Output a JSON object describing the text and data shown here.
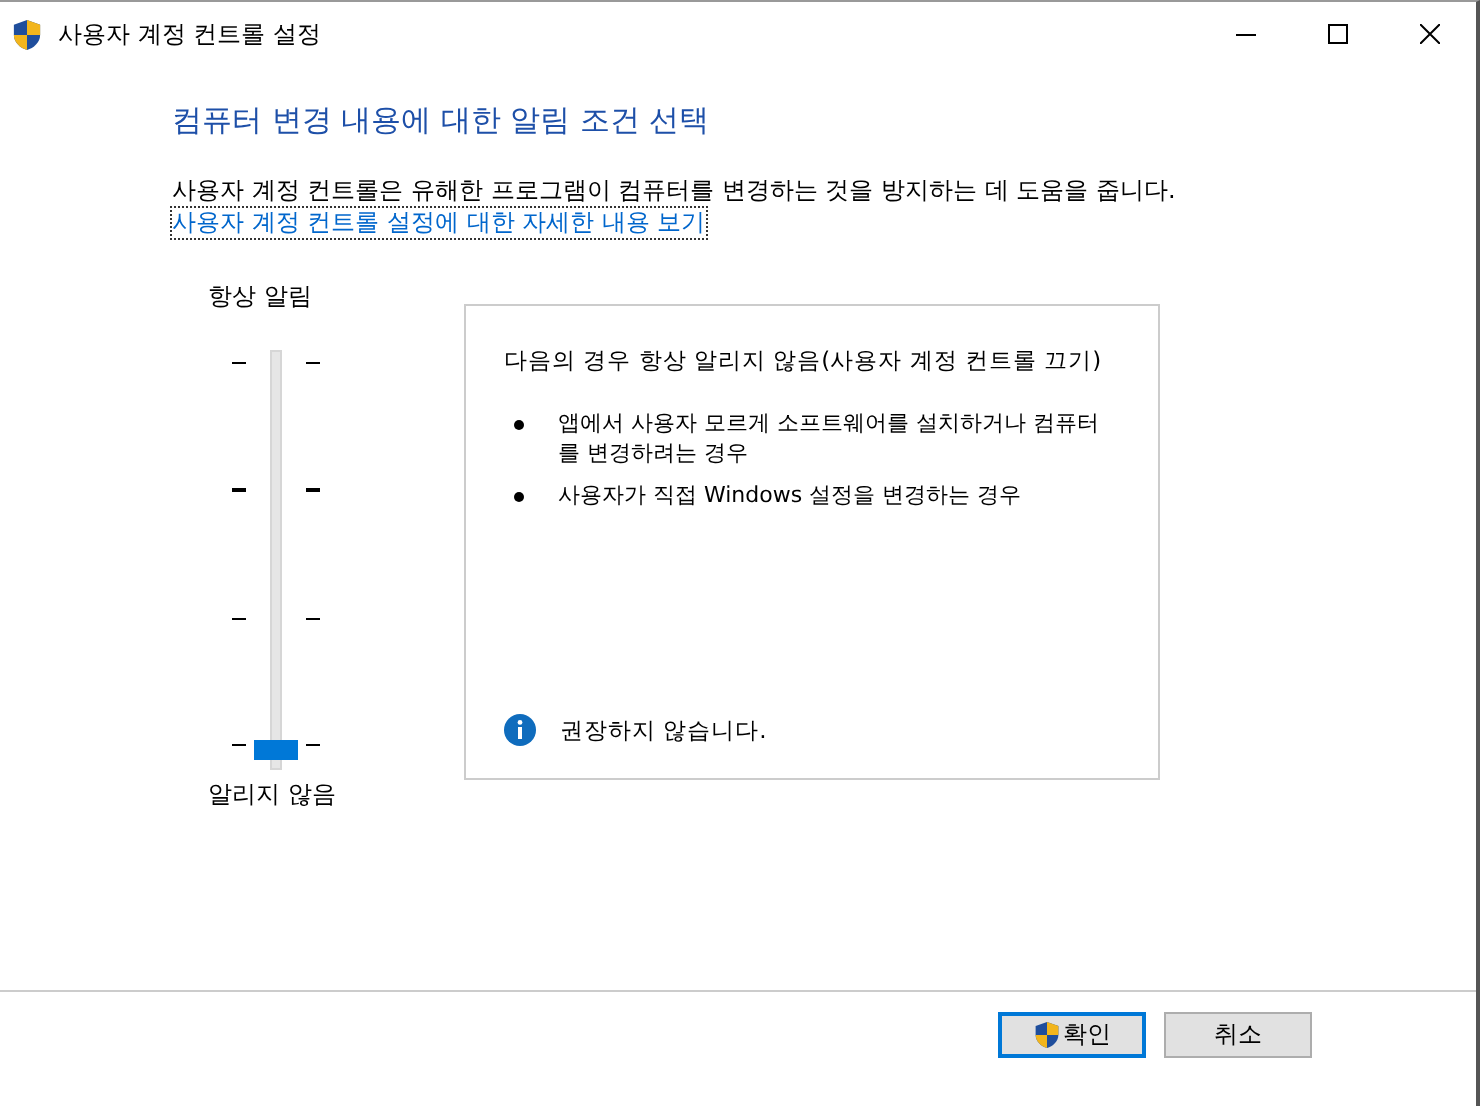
{
  "window": {
    "title": "사용자 계정 컨트롤 설정"
  },
  "heading": "컴퓨터 변경 내용에 대한 알림 조건 선택",
  "description": "사용자 계정 컨트롤은 유해한 프로그램이 컴퓨터를 변경하는 것을 방지하는 데 도움을 줍니다.",
  "link": "사용자 계정 컨트롤 설정에 대한 자세한 내용 보기",
  "slider": {
    "top_label": "항상 알림",
    "bottom_label": "알리지 않음",
    "level": 0
  },
  "info_panel": {
    "title": "다음의 경우 항상 알리지 않음(사용자 계정 컨트롤 끄기)",
    "bullets": [
      "앱에서 사용자 모르게 소프트웨어를 설치하거나 컴퓨터를 변경하려는 경우",
      "사용자가 직접 Windows 설정을 변경하는 경우"
    ],
    "note": "권장하지 않습니다."
  },
  "buttons": [
    {
      "label": "확인",
      "kind": "default"
    },
    {
      "label": "취소",
      "kind": "normal"
    }
  ]
}
